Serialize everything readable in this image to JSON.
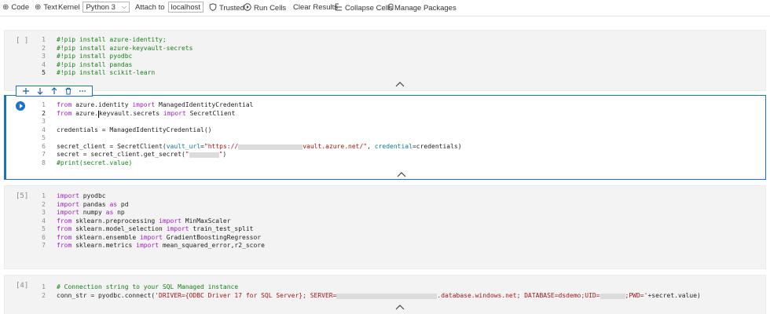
{
  "toolbar": {
    "code_label": "Code",
    "text_label": "Text",
    "kernel_label": "Kernel",
    "kernel_value": "Python 3",
    "attach_label": "Attach to",
    "attach_value": "localhost",
    "trusted_label": "Trusted",
    "run_cells_label": "Run Cells",
    "clear_results_label": "Clear Results",
    "collapse_cells_label": "Collapse Cells",
    "manage_packages_label": "Manage Packages"
  },
  "cells": [
    {
      "exec_label": "[ ]",
      "lines": [
        {
          "n": "1",
          "text": "#!pip install azure-identity;"
        },
        {
          "n": "2",
          "text": "#!pip install azure-keyvault-secrets"
        },
        {
          "n": "3",
          "text": "#!pip install pyodbc"
        },
        {
          "n": "4",
          "text": "#!pip install pandas"
        },
        {
          "n": "5",
          "text": "#!pip install scikit-learn"
        }
      ]
    },
    {
      "exec_label": "",
      "lines": [
        {
          "n": "1",
          "p1": "from",
          "p2": " azure.identity ",
          "p3": "import",
          "p4": " ManagedIdentityCredential"
        },
        {
          "n": "2",
          "p1": "from",
          "p2a": " azure.",
          "p2b": "keyvault.secrets ",
          "p3": "import",
          "p4": " SecretClient"
        },
        {
          "n": "3"
        },
        {
          "n": "4",
          "text": "credentials = ManagedIdentityCredential()"
        },
        {
          "n": "5"
        },
        {
          "n": "6",
          "a": "secret_client = SecretClient(",
          "b": "vault_url",
          "c": "=",
          "d": "\"https://",
          "e": "vault.azure.net/\"",
          "f": ", ",
          "g": "credential",
          "h": "=credentials)"
        },
        {
          "n": "7",
          "a": "secret = secret_client.get_secret(",
          "d": "\"",
          "e": "\"",
          "h": ")"
        },
        {
          "n": "8",
          "text": "#print(secret.value)"
        }
      ]
    },
    {
      "exec_label": "[5]",
      "lines": [
        {
          "n": "1",
          "k": "import",
          "r": " pyodbc"
        },
        {
          "n": "2",
          "k": "import",
          "r": " pandas ",
          "k2": "as",
          "r2": " pd"
        },
        {
          "n": "3",
          "k": "import",
          "r": " numpy ",
          "k2": "as",
          "r2": " np"
        },
        {
          "n": "4",
          "k": "from",
          "r": " sklearn.preprocessing ",
          "k2": "import",
          "r2": " MinMaxScaler"
        },
        {
          "n": "5",
          "k": "from",
          "r": " sklearn.model_selection ",
          "k2": "import",
          "r2": " train_test_split"
        },
        {
          "n": "6",
          "k": "from",
          "r": " sklearn.ensemble ",
          "k2": "import",
          "r2": " GradientBoostingRegressor"
        },
        {
          "n": "7",
          "k": "from",
          "r": " sklearn.metrics ",
          "k2": "import",
          "r2": " mean_squared_error,r2_score"
        }
      ]
    },
    {
      "exec_label": "[4]",
      "lines": [
        {
          "n": "1",
          "text": "# Connection string to your SQL Managed instance"
        },
        {
          "n": "2",
          "a": "conn_str = pyodbc.connect(",
          "s1": "'DRIVER={ODBC Driver 17 for SQL Server}; SERVER=",
          "s2": ".database.windows.net; DATABASE=dsdemo;UID=",
          "s3": ";PWD='",
          "t": "+secret.value)"
        }
      ]
    }
  ],
  "colors": {
    "accent": "#1a73c7",
    "comment": "#168216",
    "keyword": "#a31cc2",
    "string": "#a31515",
    "cell_bg": "#f3f3f3"
  },
  "icons": {
    "code": "plus-icon",
    "text": "plus-icon",
    "trusted": "shield-icon",
    "run": "play-circle-icon",
    "collapse": "collapse-icon",
    "packages": "package-icon"
  }
}
